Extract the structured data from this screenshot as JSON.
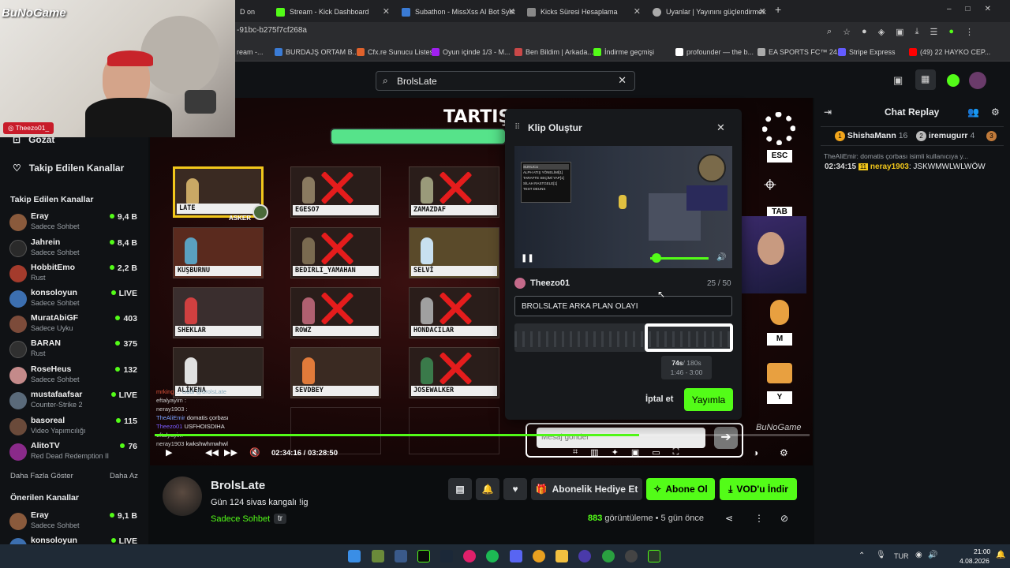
{
  "browser": {
    "tabs": [
      {
        "label": "D on",
        "color": "#53fc18"
      },
      {
        "label": "Stream - Kick Dashboard",
        "color": "#53fc18"
      },
      {
        "label": "Subathon - MissXss AI Bot Syst",
        "color": "#3a7bd5"
      },
      {
        "label": "Kicks Süresi Hesaplama",
        "color": "#888888"
      },
      {
        "label": "Uyanlar | Yayınını güçlendirmek",
        "color": "#aaaaaa"
      }
    ],
    "url": "-91bc-b275f7cf268a",
    "bookmarks": [
      "ream -...",
      "BURDAJŞ ORTAM B...",
      "Cfx.re Sunucu Listesi",
      "Oyun içinde 1/3 - M...",
      "Ben Bildim | Arkada...",
      "İndirme geçmişi",
      "profounder — the b...",
      "EA SPORTS FC™ 24...",
      "Stripe Express",
      "(49) 22 HAYKO CEP..."
    ]
  },
  "watermark": "BuNoGame",
  "webcam_tag": "Theezo01_",
  "search": {
    "value": "BrolsLate"
  },
  "sidebar": {
    "browse": "Gözat",
    "following_link": "Takip Edilen Kanallar",
    "following_header": "Takip Edilen Kanallar",
    "channels": [
      {
        "name": "Eray",
        "category": "Sadece Sohbet",
        "viewers": "9,4 B",
        "color": "#8a5a3c"
      },
      {
        "name": "Jahrein",
        "category": "Sadece Sohbet",
        "viewers": "8,4 B",
        "color": "#2a2a2a"
      },
      {
        "name": "HobbitEmo",
        "category": "Rust",
        "viewers": "2,2 B",
        "color": "#a43b2c"
      },
      {
        "name": "konsoloyun",
        "category": "Sadece Sohbet",
        "viewers": "LIVE",
        "color": "#3c6fb0"
      },
      {
        "name": "MuratAbiGF",
        "category": "Sadece Uyku",
        "viewers": "403",
        "color": "#7c4b3a"
      },
      {
        "name": "BARAN",
        "category": "Rust",
        "viewers": "375",
        "color": "#303030"
      },
      {
        "name": "RoseHeus",
        "category": "Sadece Sohbet",
        "viewers": "132",
        "color": "#c48a8a"
      },
      {
        "name": "mustafaafsar",
        "category": "Counter-Strike 2",
        "viewers": "LIVE",
        "color": "#5a6a7a"
      },
      {
        "name": "basoreal",
        "category": "Video Yapımcılığı",
        "viewers": "115",
        "color": "#6a4a3a"
      },
      {
        "name": "AlitoTV",
        "category": "Red Dead Redemption II",
        "viewers": "76",
        "color": "#8a2a8a"
      }
    ],
    "show_more": "Daha Fazla Göster",
    "show_less": "Daha Az",
    "recommended_header": "Önerilen Kanallar",
    "recommended": [
      {
        "name": "Eray",
        "category": "Sadece Sohbet",
        "viewers": "9,1 B",
        "color": "#8a5a3c"
      },
      {
        "name": "konsoloyun",
        "category": "",
        "viewers": "LIVE",
        "color": "#3c6fb0"
      }
    ]
  },
  "game": {
    "title": "TARTIŞM",
    "players": [
      {
        "name": "LATE",
        "dead": false,
        "badge": "ASKER",
        "highlight": true
      },
      {
        "name": "EGESO7",
        "dead": true
      },
      {
        "name": "ZAMAZDAF",
        "dead": true
      },
      {
        "name": "KUŞBURNU",
        "dead": false
      },
      {
        "name": "BEDIRLI_YAMAHAN",
        "dead": true
      },
      {
        "name": "SELVİ",
        "dead": false
      },
      {
        "name": "SHEKLAR",
        "dead": false
      },
      {
        "name": "ROWZ",
        "dead": true
      },
      {
        "name": "HONDACILAR",
        "dead": true
      },
      {
        "name": "ALİKENA",
        "dead": false
      },
      {
        "name": "SEVDBEY",
        "dead": false
      },
      {
        "name": "JOSEWALKER",
        "dead": true
      }
    ],
    "overlay_chat": [
      {
        "user": "mrking",
        "text": "... ciddi @brolsLate"
      },
      {
        "user": "eftalyayim",
        "text": ":"
      },
      {
        "user": "neray1903",
        "text": ":"
      },
      {
        "user": "TheAliEmir",
        "text": "domatis çorbası"
      },
      {
        "user": "Theezo01",
        "text": "USFHOISDIHA"
      },
      {
        "user": "eftalyayim",
        "text": ""
      },
      {
        "user": "neray1903",
        "text": "kwkshwhmwhwl"
      }
    ],
    "message_placeholder": "Mesaj gönder",
    "hud_keys": [
      "ESC",
      "TAB",
      "M",
      "Y"
    ]
  },
  "player_controls": {
    "time": "02:34:16 / 03:28:50",
    "progress": 0.74
  },
  "clip_modal": {
    "title": "Klip Oluştur",
    "user": "Theezo01",
    "char_count": "25 / 50",
    "clip_title": "BROLSLATE ARKA PLAN OLAYI",
    "duration": "74s",
    "max_duration": "/ 180s",
    "range": "1:46 - 3:00",
    "cancel": "İptal et",
    "publish": "Yayımla",
    "preview_menu": [
      "SUNUCU",
      "ALPH ATIŞ YÖNELİMİ[1]",
      "TARAFTE SEÇİMİ YAP[1]",
      "SİLAH RASTGELE[1]",
      "TEST DEUNS"
    ]
  },
  "stream": {
    "name": "BrolsLate",
    "title": "Gün 124 sivas kangalı !ig",
    "category": "Sadece Sohbet",
    "language": "tr",
    "views_count": "883",
    "views_label": "görüntüleme",
    "age": "5 gün önce",
    "gift_sub": "Abonelik Hediye Et",
    "subscribe": "Abone Ol",
    "download_vod": "VOD'u İndir"
  },
  "chat": {
    "title": "Chat Replay",
    "gifters": [
      {
        "rank": "1",
        "name": "ShishaMann",
        "count": "16"
      },
      {
        "rank": "2",
        "name": "iremugurr",
        "count": "4"
      },
      {
        "rank": "3",
        "name": "",
        "count": ""
      }
    ],
    "reply_preview": "TheAliEmir: domatis çorbası isimli kullanıcıya y...",
    "messages": [
      {
        "time": "02:34:15",
        "badge": "11",
        "user": "neray1903",
        "text": "JSKWMWLWLWÖW"
      }
    ]
  },
  "taskbar": {
    "lang": "TUR",
    "time": "21:00",
    "date": "4.08.2026"
  },
  "colors": {
    "kick_green": "#53fc18",
    "bg": "#0b0d0f",
    "panel": "#101215"
  }
}
